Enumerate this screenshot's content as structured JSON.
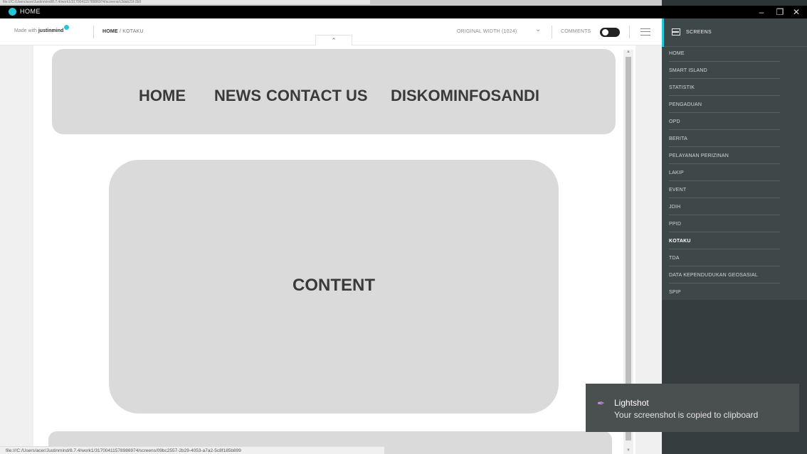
{
  "window": {
    "title": "HOME",
    "url_strip": "file:///C:/Users/acer/Justinmind/8.7.4/work1/31700411578986974/screens/c3dab21f-2b9",
    "minimize_label": "–",
    "maximize_label": "❐",
    "close_label": "✕"
  },
  "toolbar": {
    "brand_prefix": "Made with",
    "brand_name": "justinmind",
    "breadcrumb_home": "HOME",
    "breadcrumb_sep": "/",
    "breadcrumb_current": "KOTAKU",
    "original_width": "ORIGINAL WIDTH (1024)",
    "comments_label": "COMMENTS",
    "comments_on": true,
    "collapse_icon": "chevron-up-icon"
  },
  "page": {
    "nav_items": [
      "HOME",
      "NEWS",
      "CONTACT US",
      "DISKOMINFOSANDI"
    ],
    "content_label": "CONTENT"
  },
  "sidebar": {
    "title": "SCREENS",
    "items": [
      {
        "label": "HOME",
        "active": false
      },
      {
        "label": "SMART ISLAND",
        "active": false
      },
      {
        "label": "STATISTIK",
        "active": false
      },
      {
        "label": "PENGADUAN",
        "active": false
      },
      {
        "label": "OPD",
        "active": false
      },
      {
        "label": "BERITA",
        "active": false
      },
      {
        "label": "PELAYANAN PERIZINAN",
        "active": false
      },
      {
        "label": "LAKIP",
        "active": false
      },
      {
        "label": "EVENT",
        "active": false
      },
      {
        "label": "JDIH",
        "active": false
      },
      {
        "label": "PPID",
        "active": false
      },
      {
        "label": "KOTAKU",
        "active": true
      },
      {
        "label": "TDA",
        "active": false
      },
      {
        "label": "DATA KEPENDUDUKAN GEOSASIAL",
        "active": false
      },
      {
        "label": "SPIP",
        "active": false
      }
    ]
  },
  "statusbar": {
    "text": "file:///C:/Users/acer/Justinmind/8.7.4/work1/31700411578986974/screens/09bc2557-2b29-4053-a7a2-5c8f185b899"
  },
  "toast": {
    "title": "Lightshot",
    "message": "Your screenshot is copied to clipboard"
  },
  "colors": {
    "accent": "#26c6da",
    "sidebar_bg": "#3e4849",
    "placeholder_gray": "#dadada"
  }
}
